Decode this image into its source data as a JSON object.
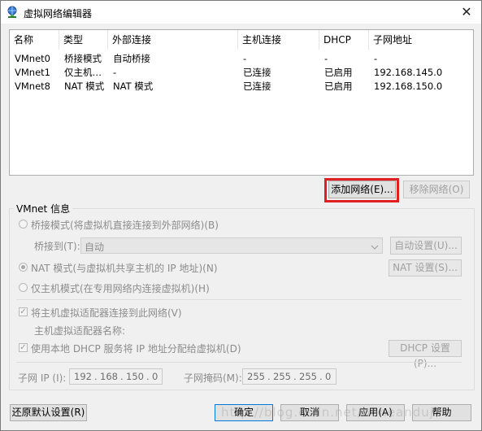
{
  "window": {
    "title": "虚拟网络编辑器",
    "icon": "network-globe-icon",
    "close_glyph": "✕"
  },
  "network_list": {
    "columns": [
      "名称",
      "类型",
      "外部连接",
      "主机连接",
      "DHCP",
      "子网地址"
    ],
    "rows": [
      [
        "VMnet0",
        "桥接模式",
        "自动桥接",
        "-",
        "-",
        "-"
      ],
      [
        "VMnet1",
        "仅主机…",
        "-",
        "已连接",
        "已启用",
        "192.168.145.0"
      ],
      [
        "VMnet8",
        "NAT 模式",
        "NAT 模式",
        "已连接",
        "已启用",
        "192.168.150.0"
      ]
    ]
  },
  "buttons": {
    "add_network": "添加网络(E)...",
    "remove_network": "移除网络(O)",
    "auto_settings": "自动设置(U)...",
    "nat_settings": "NAT 设置(S)...",
    "dhcp_settings": "DHCP 设置(P)...",
    "restore_defaults": "还原默认设置(R)",
    "ok": "确定",
    "cancel": "取消",
    "apply": "应用(A)",
    "help": "帮助"
  },
  "vmnet_info": {
    "label": "VMnet 信息",
    "bridged_mode": "桥接模式(将虚拟机直接连接到外部网络)(B)",
    "bridged_to_label": "桥接到(T):",
    "bridged_to_value": "自动",
    "nat_mode": "NAT 模式(与虚拟机共享主机的 IP 地址)(N)",
    "host_only_mode": "仅主机模式(在专用网络内连接虚拟机)(H)",
    "selected_mode": "nat",
    "connect_adapter": "将主机虚拟适配器连接到此网络(V)",
    "connect_adapter_checked": true,
    "adapter_name_label": "主机虚拟适配器名称:",
    "use_dhcp": "使用本地 DHCP 服务将 IP 地址分配给虚拟机(D)",
    "use_dhcp_checked": true,
    "subnet_ip_label": "子网 IP (I):",
    "subnet_ip": [
      "192",
      "168",
      "150",
      "0"
    ],
    "subnet_mask_label": "子网掩码(M):",
    "subnet_mask": [
      "255",
      "255",
      "255",
      "0"
    ]
  },
  "watermark": "http://blog.csdn.net/honeanduji"
}
